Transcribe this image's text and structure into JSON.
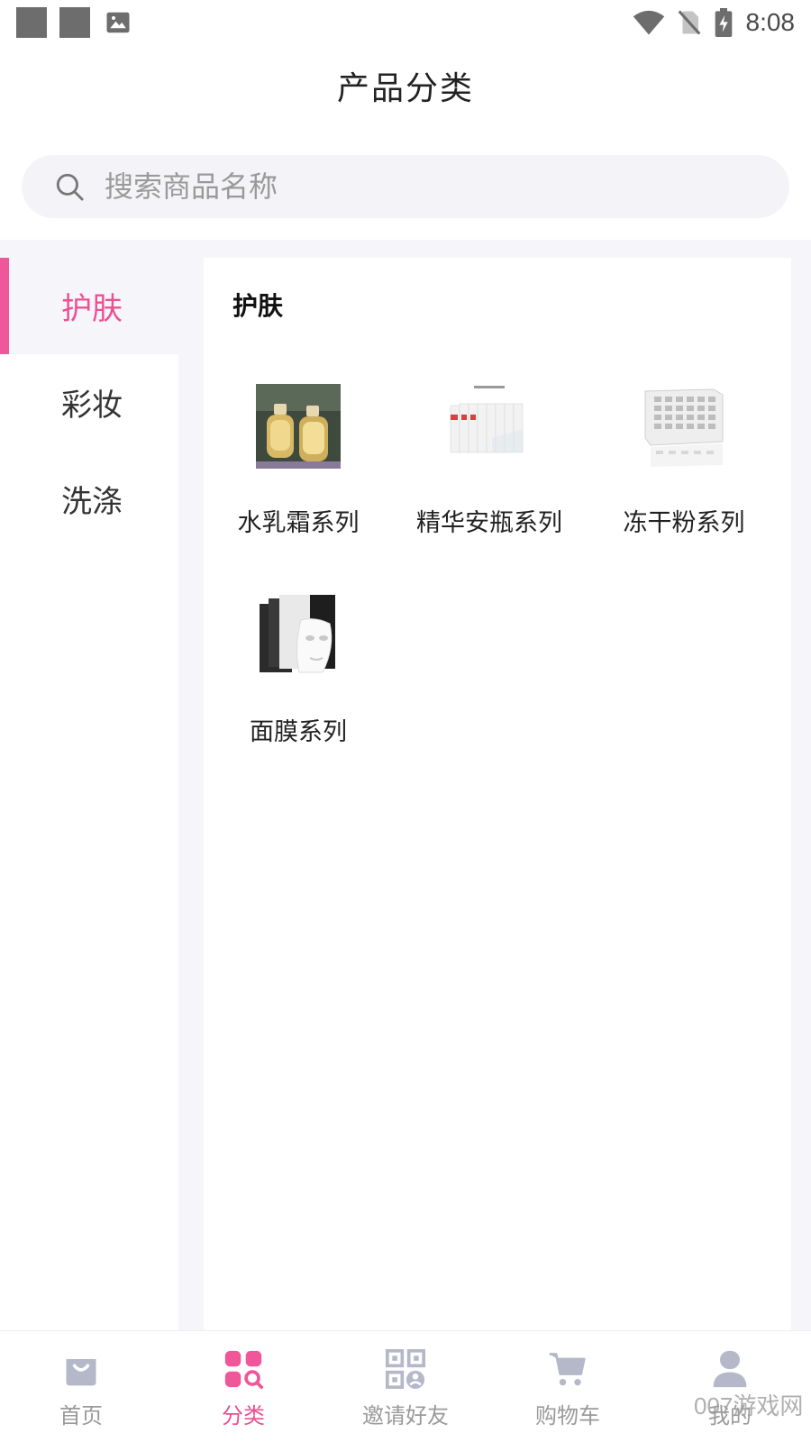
{
  "status_bar": {
    "time": "8:08"
  },
  "header": {
    "title": "产品分类"
  },
  "search": {
    "placeholder": "搜索商品名称"
  },
  "sidebar": {
    "items": [
      {
        "label": "护肤",
        "active": true
      },
      {
        "label": "彩妆",
        "active": false
      },
      {
        "label": "洗涤",
        "active": false
      }
    ]
  },
  "panel": {
    "title": "护肤",
    "items": [
      {
        "label": "水乳霜系列",
        "icon": "bottles-image"
      },
      {
        "label": "精华安瓶系列",
        "icon": "ampoule-packets-image"
      },
      {
        "label": "冻干粉系列",
        "icon": "powder-box-image"
      },
      {
        "label": "面膜系列",
        "icon": "face-mask-image"
      }
    ]
  },
  "tabbar": {
    "items": [
      {
        "label": "首页",
        "icon": "shopping-bag-icon",
        "active": false
      },
      {
        "label": "分类",
        "icon": "category-grid-icon",
        "active": true
      },
      {
        "label": "邀请好友",
        "icon": "qr-code-icon",
        "active": false
      },
      {
        "label": "购物车",
        "icon": "cart-icon",
        "active": false
      },
      {
        "label": "我的",
        "icon": "user-icon",
        "active": false
      }
    ]
  },
  "watermark": "007游戏网"
}
